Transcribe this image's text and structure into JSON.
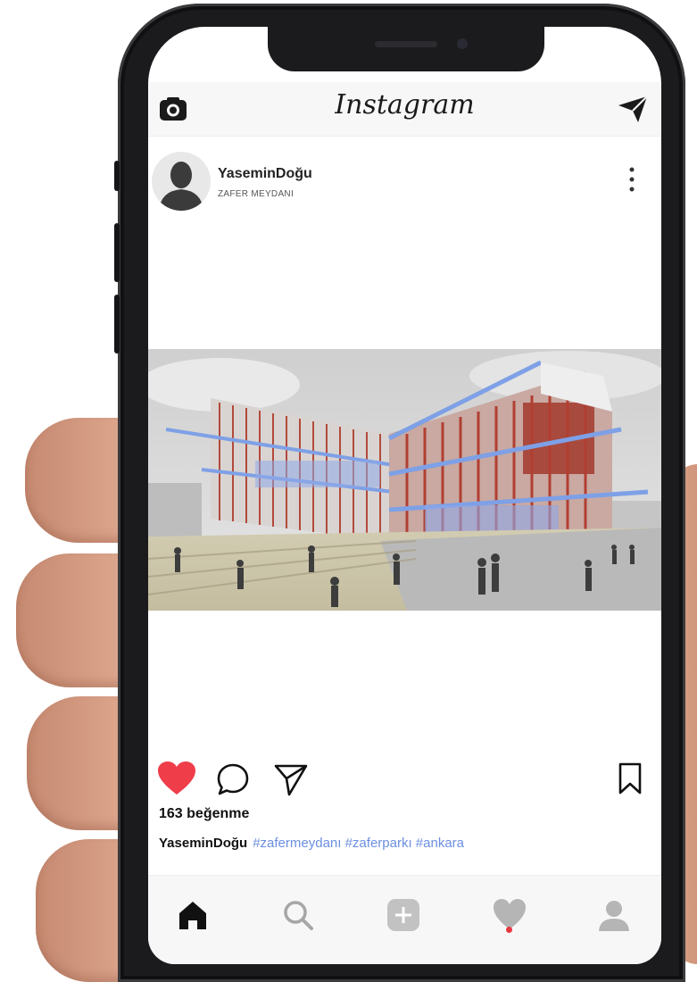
{
  "header": {
    "brand": "Instagram",
    "camera_icon": "camera-icon",
    "direct_icon": "paper-plane-icon"
  },
  "post": {
    "username": "YaseminDoğu",
    "location": "ZAFER MEYDANI",
    "image_description_icon": "architecture-render-image",
    "likes_text": "163 beğenme",
    "caption_user": "YaseminDoğu",
    "caption_tags": "#zafermeydanı #zaferparkı #ankara"
  },
  "actions": {
    "like_icon": "heart-filled-icon",
    "comment_icon": "comment-bubble-icon",
    "share_icon": "paper-plane-icon",
    "save_icon": "bookmark-icon"
  },
  "tabbar": {
    "items": [
      "home-icon",
      "search-icon",
      "add-post-icon",
      "activity-heart-icon",
      "profile-icon"
    ]
  },
  "colors": {
    "like": "#ef3e4a",
    "hashtag": "#6b8fe0",
    "notification_dot": "#e8373e"
  }
}
